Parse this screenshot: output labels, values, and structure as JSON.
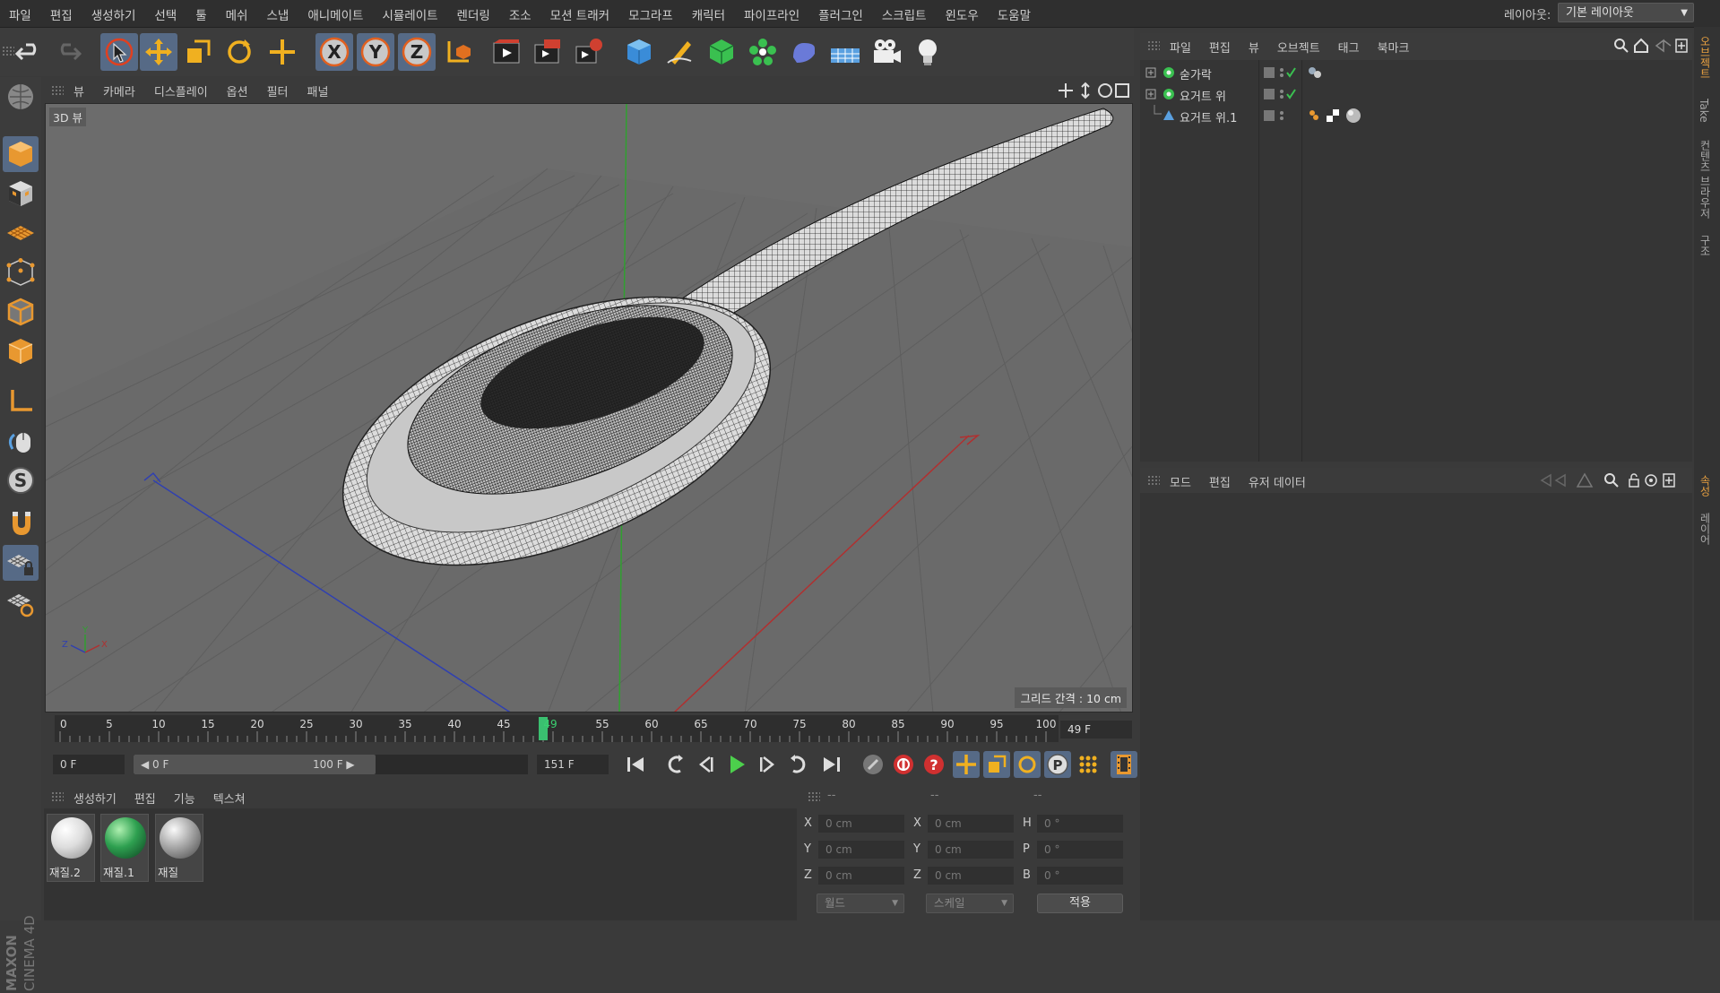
{
  "menubar": {
    "items": [
      "파일",
      "편집",
      "생성하기",
      "선택",
      "툴",
      "메쉬",
      "스냅",
      "애니메이트",
      "시뮬레이트",
      "렌더링",
      "조소",
      "모션 트래커",
      "모그라프",
      "캐릭터",
      "파이프라인",
      "플러그인",
      "스크립트",
      "윈도우",
      "도움말"
    ],
    "layout_label": "레이아웃:",
    "layout_value": "기본 레이아웃"
  },
  "toolbar": {
    "axis_x": "X",
    "axis_y": "Y",
    "axis_z": "Z",
    "icons": [
      "undo-icon",
      "redo-icon",
      "live-select-icon",
      "move-icon",
      "scale-icon",
      "rotate-icon",
      "last-tool-icon",
      "x-axis-icon",
      "y-axis-icon",
      "z-axis-icon",
      "coordinate-system-icon",
      "render-view-icon",
      "render-picture-viewer-icon",
      "render-settings-icon",
      "cube-icon",
      "pen-icon",
      "subdivision-icon",
      "array-icon",
      "deformer-icon",
      "floor-icon",
      "camera-icon",
      "light-icon"
    ]
  },
  "viewport": {
    "menu": [
      "뷰",
      "카메라",
      "디스플레이",
      "옵션",
      "필터",
      "패널"
    ],
    "label": "3D 뷰",
    "grid_spacing": "그리드 간격 : 10 cm",
    "axis_labels": {
      "x": "X",
      "y": "Y",
      "z": "Z"
    },
    "colors": {
      "background": "#6c6c6c",
      "grid": "#5e5e5e",
      "x_axis": "#b03030",
      "y_axis": "#30a030",
      "z_axis": "#3040b0"
    }
  },
  "timeline": {
    "ticks": [
      "0",
      "5",
      "10",
      "15",
      "20",
      "25",
      "30",
      "35",
      "40",
      "45",
      "49",
      "55",
      "60",
      "65",
      "70",
      "75",
      "80",
      "85",
      "90",
      "95",
      "100"
    ],
    "current_frame": 49,
    "max_frame": 100,
    "frame_field": "49 F"
  },
  "transport": {
    "start_field": "0 F",
    "range_start": "◀ 0 F",
    "range_end": "100 F ▶",
    "end_field": "151 F"
  },
  "materials": {
    "menu": [
      "생성하기",
      "편집",
      "기능",
      "텍스쳐"
    ],
    "items": [
      {
        "name": "재질.2",
        "color": "#e8e8e0"
      },
      {
        "name": "재질.1",
        "color": "#2ea050"
      },
      {
        "name": "재질",
        "color": "#a8a8a8"
      }
    ]
  },
  "coordinates": {
    "headers": [
      "--",
      "--",
      "--"
    ],
    "rows": [
      {
        "pos_label": "X",
        "pos": "0 cm",
        "size_label": "X",
        "size": "0 cm",
        "rot_label": "H",
        "rot": "0 °"
      },
      {
        "pos_label": "Y",
        "pos": "0 cm",
        "size_label": "Y",
        "size": "0 cm",
        "rot_label": "P",
        "rot": "0 °"
      },
      {
        "pos_label": "Z",
        "pos": "0 cm",
        "size_label": "Z",
        "size": "0 cm",
        "rot_label": "B",
        "rot": "0 °"
      }
    ],
    "mode_world": "월드",
    "mode_scale": "스케일",
    "apply": "적용"
  },
  "object_manager": {
    "menu": [
      "파일",
      "편집",
      "뷰",
      "오브젝트",
      "태그",
      "북마크"
    ],
    "objects": [
      {
        "name": "숟가락"
      },
      {
        "name": "요거트 위"
      },
      {
        "name": "요거트 위.1"
      }
    ]
  },
  "attribute_manager": {
    "menu": [
      "모드",
      "편집",
      "유저 데이터"
    ]
  },
  "right_tabs": [
    "오브젝트",
    "Take",
    "컨텐츠 브라우저",
    "구조",
    "속성",
    "레이어"
  ],
  "brand": "MAXON CINEMA 4D"
}
